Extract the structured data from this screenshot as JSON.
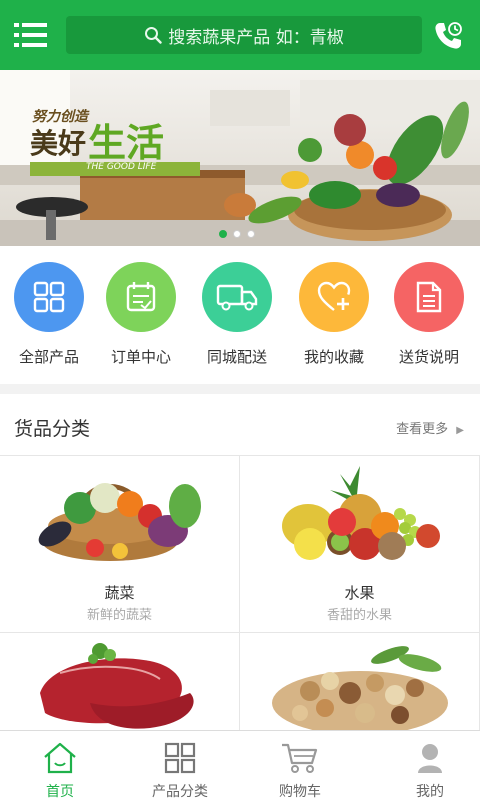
{
  "header": {
    "search_placeholder": "搜索蔬果产品 如：青椒",
    "colors": {
      "primary": "#1fb14a",
      "search_bg": "#18993c"
    }
  },
  "banner": {
    "slogan_small": "努力创造",
    "slogan_big_1": "美好",
    "slogan_big_2": "生活",
    "slogan_en": "THE GOOD LIFE",
    "active_dot": 1,
    "dot_count": 3
  },
  "quick": {
    "items": [
      {
        "label": "全部产品",
        "icon": "grid-icon",
        "color": "#4d97f0"
      },
      {
        "label": "订单中心",
        "icon": "calendar-icon",
        "color": "#7ed35a"
      },
      {
        "label": "同城配送",
        "icon": "truck-icon",
        "color": "#3ccf97"
      },
      {
        "label": "我的收藏",
        "icon": "heart-plus-icon",
        "color": "#fdb83a"
      },
      {
        "label": "送货说明",
        "icon": "document-icon",
        "color": "#f56464"
      }
    ]
  },
  "category": {
    "title": "货品分类",
    "more": "查看更多",
    "items": [
      {
        "name": "蔬菜",
        "sub": "新鲜的蔬菜"
      },
      {
        "name": "水果",
        "sub": "香甜的水果"
      },
      {
        "name": "",
        "sub": ""
      },
      {
        "name": "",
        "sub": ""
      }
    ]
  },
  "tabbar": {
    "items": [
      {
        "label": "首页",
        "icon": "home-icon",
        "active": true
      },
      {
        "label": "产品分类",
        "icon": "category-icon",
        "active": false
      },
      {
        "label": "购物车",
        "icon": "cart-icon",
        "active": false
      },
      {
        "label": "我的",
        "icon": "user-icon",
        "active": false
      }
    ]
  }
}
